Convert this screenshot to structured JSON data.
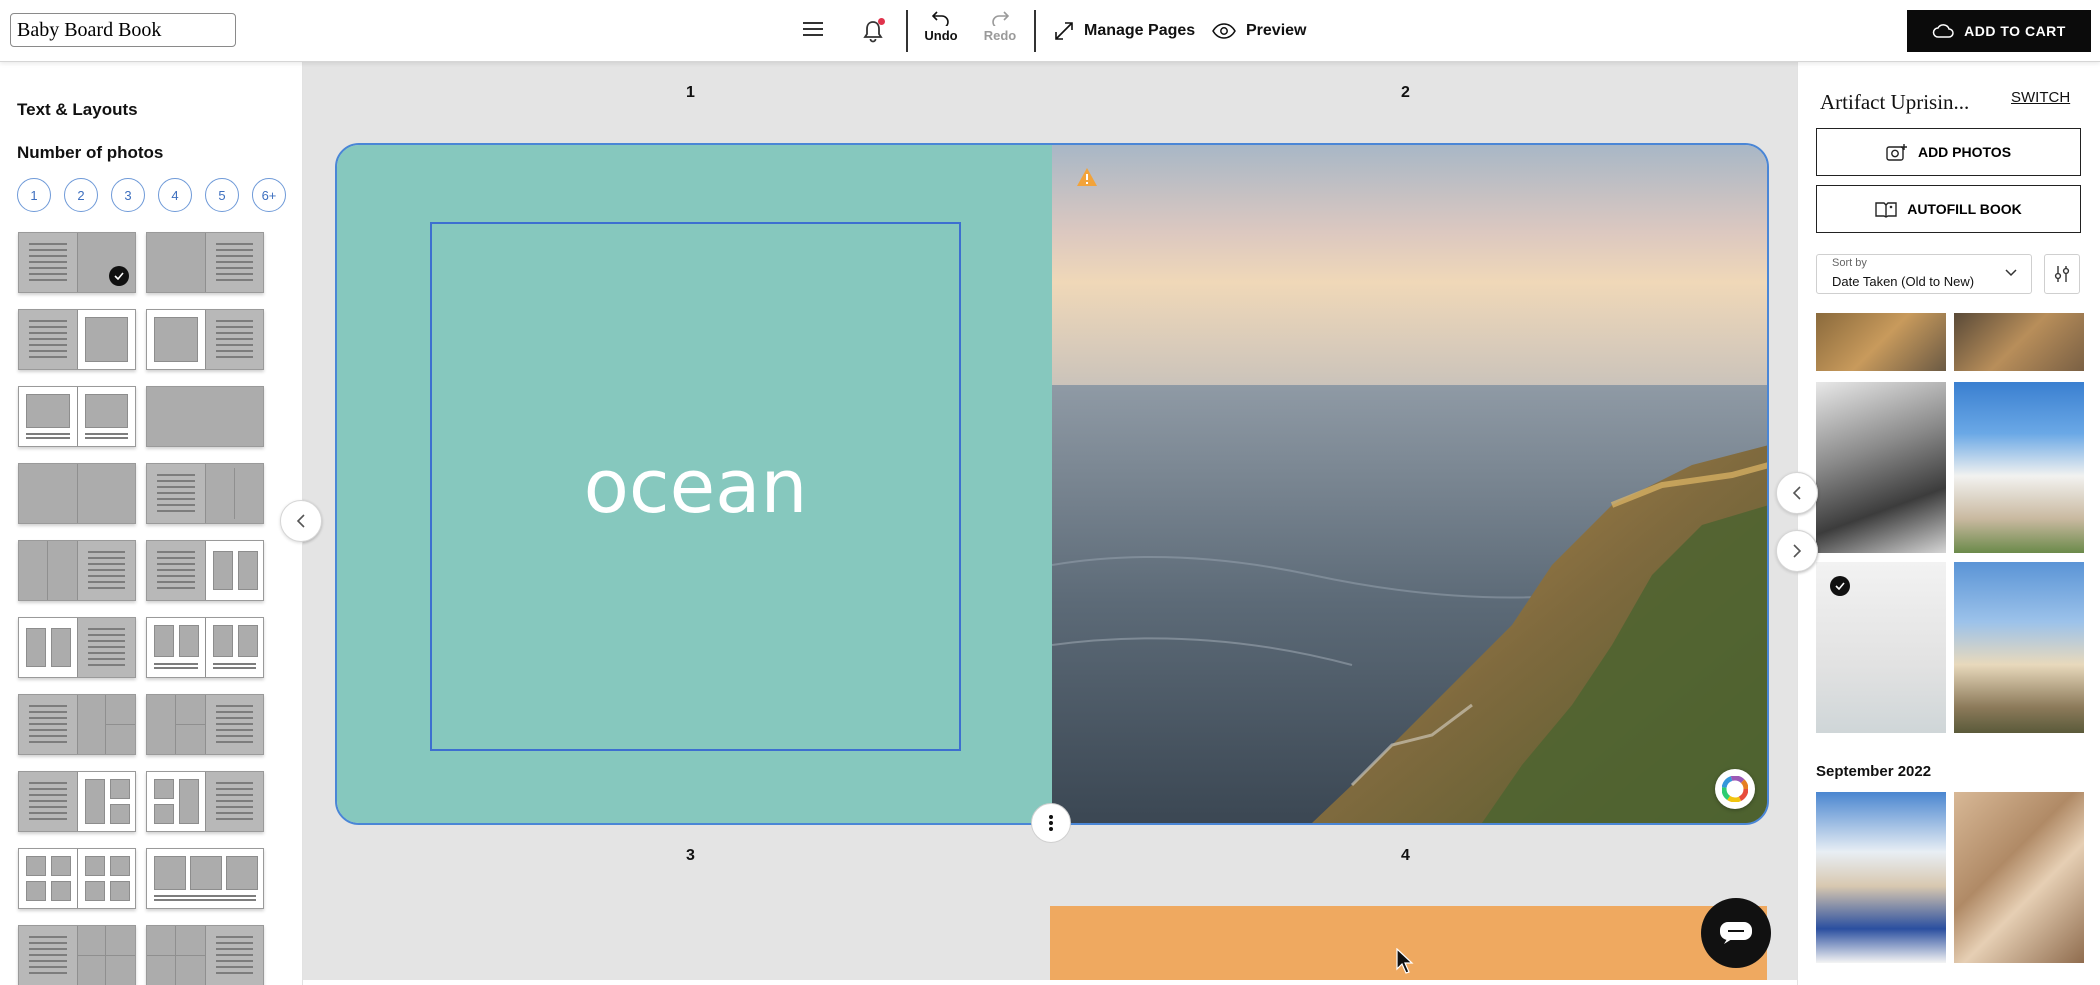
{
  "toolbar": {
    "book_title": "Baby Board Book",
    "undo_label": "Undo",
    "redo_label": "Redo",
    "manage_pages_label": "Manage Pages",
    "preview_label": "Preview",
    "add_to_cart_label": "ADD TO CART"
  },
  "left_panel": {
    "section_title": "Text & Layouts",
    "photo_count_title": "Number of photos",
    "photo_counts": [
      "1",
      "2",
      "3",
      "4",
      "5",
      "6+"
    ]
  },
  "canvas": {
    "page_numbers": [
      "1",
      "2",
      "3",
      "4"
    ],
    "text_block": "ocean",
    "left_page_color": "#86c8be",
    "page4_color": "#efa960"
  },
  "right_panel": {
    "album_name": "Artifact Uprisin...",
    "switch_label": "SWITCH",
    "add_photos_label": "ADD PHOTOS",
    "autofill_label": "AUTOFILL BOOK",
    "sort_label": "Sort by",
    "sort_value": "Date Taken (Old to New)",
    "section_month": "September 2022"
  },
  "colors": {
    "accent_blue": "#4a86d6",
    "warning": "#f2a33a",
    "cart_bg": "#0b0b0b"
  }
}
